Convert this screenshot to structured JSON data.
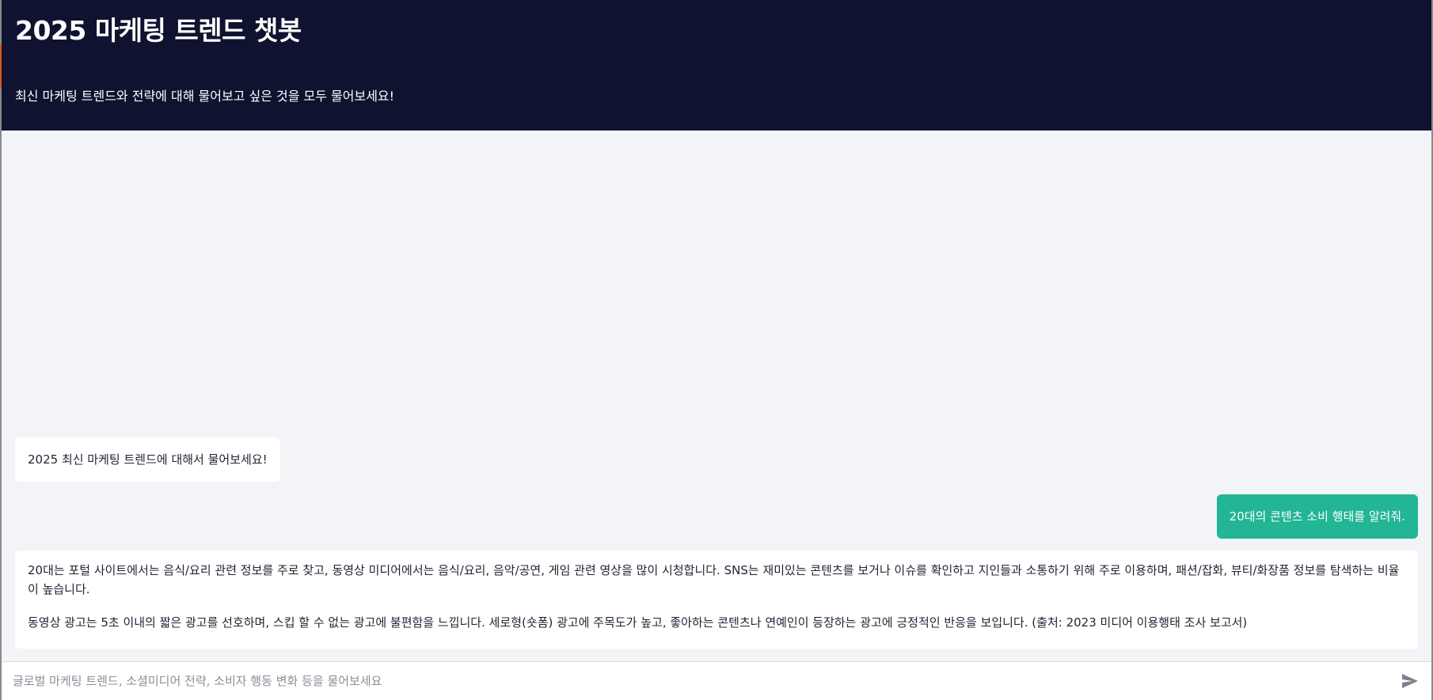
{
  "header": {
    "title": "2025 마케팅 트렌드 챗봇",
    "subtitle": "최신 마케팅 트렌드와 전략에 대해 물어보고 싶은 것을 모두 물어보세요!",
    "background_color": "#0f1330"
  },
  "chat": {
    "messages": [
      {
        "role": "bot",
        "text": "2025 최신 마케팅 트렌드에 대해서 물어보세요!"
      },
      {
        "role": "user",
        "text": "20대의 콘텐츠 소비 행태를 알려줘.",
        "color": "#22b596"
      },
      {
        "role": "bot",
        "paragraphs": [
          "20대는 포털 사이트에서는 음식/요리 관련 정보를 주로 찾고, 동영상 미디어에서는 음식/요리, 음악/공연, 게임 관련 영상을 많이 시청합니다. SNS는 재미있는 콘텐츠를 보거나 이슈를 확인하고 지인들과 소통하기 위해 주로 이용하며, 패션/잡화, 뷰티/화장품 정보를 탐색하는 비율이 높습니다.",
          "동영상 광고는 5초 이내의 짧은 광고를 선호하며, 스킵 할 수 없는 광고에 불편함을 느낍니다. 세로형(숏폼) 광고에 주목도가 높고, 좋아하는 콘텐츠나 연예인이 등장하는 광고에 긍정적인 반응을 보입니다. (출처: 2023 미디어 이용행태 조사 보고서)"
        ]
      }
    ]
  },
  "input": {
    "placeholder": "글로벌 마케팅 트렌드, 소셜미디어 전략, 소비자 행동 변화 등을 물어보세요",
    "value": "",
    "send_icon": "send-icon"
  }
}
